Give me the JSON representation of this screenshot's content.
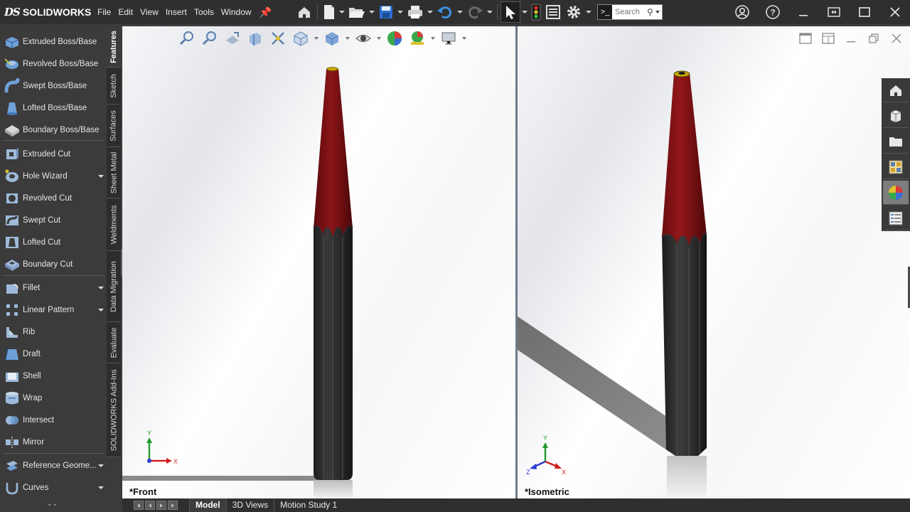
{
  "app": {
    "brand_mark": "DS",
    "name": "SOLIDWORKS",
    "menu": [
      "File",
      "Edit",
      "View",
      "Insert",
      "Tools",
      "Window"
    ]
  },
  "toolbar": {
    "search_placeholder": "Search",
    "search_prompt_icon": ">_"
  },
  "features": {
    "items": [
      {
        "id": "extruded-boss",
        "label": "Extruded Boss/Base",
        "icon": "extruded-boss-icon",
        "dropdown": false
      },
      {
        "id": "revolved-boss",
        "label": "Revolved Boss/Base",
        "icon": "revolved-boss-icon",
        "dropdown": false
      },
      {
        "id": "swept-boss",
        "label": "Swept Boss/Base",
        "icon": "swept-boss-icon",
        "dropdown": false
      },
      {
        "id": "lofted-boss",
        "label": "Lofted Boss/Base",
        "icon": "lofted-boss-icon",
        "dropdown": false
      },
      {
        "id": "boundary-boss",
        "label": "Boundary Boss/Base",
        "icon": "boundary-boss-icon",
        "dropdown": false
      },
      {
        "id": "extruded-cut",
        "label": "Extruded Cut",
        "icon": "extruded-cut-icon",
        "dropdown": false
      },
      {
        "id": "hole-wizard",
        "label": "Hole Wizard",
        "icon": "hole-wizard-icon",
        "dropdown": true
      },
      {
        "id": "revolved-cut",
        "label": "Revolved Cut",
        "icon": "revolved-cut-icon",
        "dropdown": false
      },
      {
        "id": "swept-cut",
        "label": "Swept Cut",
        "icon": "swept-cut-icon",
        "dropdown": false
      },
      {
        "id": "lofted-cut",
        "label": "Lofted Cut",
        "icon": "lofted-cut-icon",
        "dropdown": false
      },
      {
        "id": "boundary-cut",
        "label": "Boundary Cut",
        "icon": "boundary-cut-icon",
        "dropdown": false
      },
      {
        "id": "fillet",
        "label": "Fillet",
        "icon": "fillet-icon",
        "dropdown": true
      },
      {
        "id": "linear-pattern",
        "label": "Linear Pattern",
        "icon": "linear-pattern-icon",
        "dropdown": true
      },
      {
        "id": "rib",
        "label": "Rib",
        "icon": "rib-icon",
        "dropdown": false
      },
      {
        "id": "draft",
        "label": "Draft",
        "icon": "draft-icon",
        "dropdown": false
      },
      {
        "id": "shell",
        "label": "Shell",
        "icon": "shell-icon",
        "dropdown": false
      },
      {
        "id": "wrap",
        "label": "Wrap",
        "icon": "wrap-icon",
        "dropdown": false
      },
      {
        "id": "intersect",
        "label": "Intersect",
        "icon": "intersect-icon",
        "dropdown": false
      },
      {
        "id": "mirror",
        "label": "Mirror",
        "icon": "mirror-icon",
        "dropdown": false
      },
      {
        "id": "reference-geometry",
        "label": "Reference Geome...",
        "icon": "reference-geometry-icon",
        "dropdown": true
      },
      {
        "id": "curves",
        "label": "Curves",
        "icon": "curves-icon",
        "dropdown": true
      }
    ]
  },
  "command_tabs": [
    "Features",
    "Sketch",
    "Surfaces",
    "Sheet Metal",
    "Weldments",
    "Data Migration",
    "Evaluate",
    "SOLIDWORKS Add-Ins"
  ],
  "active_command_tab": "Features",
  "viewports": {
    "front": {
      "label": "*Front",
      "axis_x": "X",
      "axis_y": "Y"
    },
    "isometric": {
      "label": "*Isometric",
      "axis_x": "X",
      "axis_y": "Y",
      "axis_z": "Z"
    }
  },
  "bottom_tabs": [
    "Model",
    "3D Views",
    "Motion Study 1"
  ],
  "active_bottom_tab": "Model",
  "colors": {
    "pencil_red": "#7a1114",
    "pencil_body": "#2b2b2b",
    "pencil_tip": "#c8a800",
    "axis_x": "#d22020",
    "axis_y": "#1f9a2a",
    "axis_z": "#2a3ad0",
    "ui_dark": "#2f2f2f",
    "ui_panel": "#3b3b3b"
  },
  "task_pane": [
    "home-icon",
    "parts-icon",
    "folder-icon",
    "view-palette-icon",
    "appearances-icon",
    "custom-properties-icon"
  ],
  "active_task_pane": "appearances-icon"
}
